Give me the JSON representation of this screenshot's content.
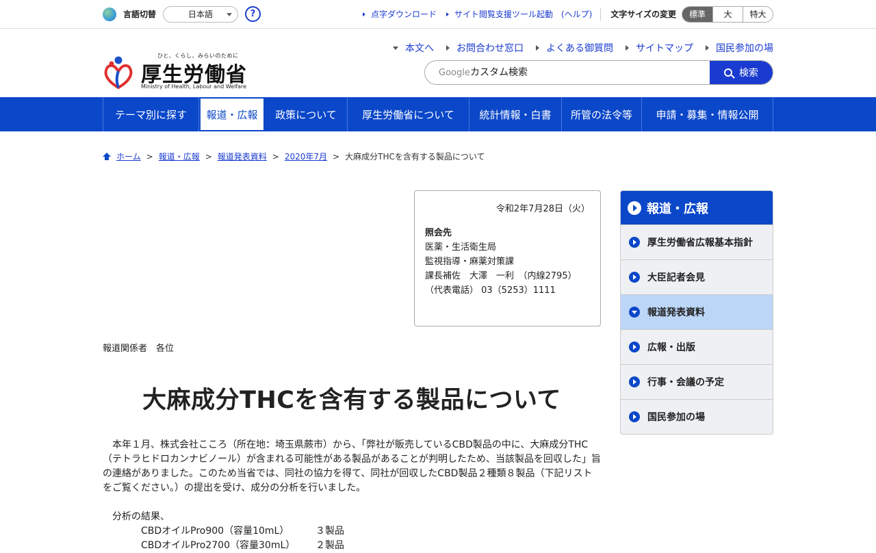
{
  "utility": {
    "language_label": "言語切替",
    "language_value": "日本語",
    "help_symbol": "?",
    "links": [
      "点字ダウンロード",
      "サイト閲覧支援ツール起動"
    ],
    "help_paren": "(ヘルプ)",
    "font_size_label": "文字サイズの変更",
    "font_sizes": [
      "標準",
      "大",
      "特大"
    ]
  },
  "header": {
    "logo_tagline": "ひと、くらし、みらいのために",
    "logo_text": "厚生労働省",
    "logo_en": "Ministry of Health, Labour and Welfare",
    "links": [
      "本文へ",
      "お問合わせ窓口",
      "よくある御質問",
      "サイトマップ",
      "国民参加の場"
    ],
    "search_brand": "Google",
    "search_placeholder": "カスタム検索",
    "search_button": "検索"
  },
  "nav": {
    "items": [
      "テーマ別に探す",
      "報道・広報",
      "政策について",
      "厚生労働省について",
      "統計情報・白書",
      "所管の法令等",
      "申請・募集・情報公開"
    ],
    "active_index": 1
  },
  "breadcrumb": {
    "items": [
      "ホーム",
      "報道・広報",
      "報道発表資料",
      "2020年7月"
    ],
    "current": "大麻成分THCを含有する製品について"
  },
  "contact": {
    "date": "令和2年7月28日（火）",
    "title": "照会先",
    "lines": [
      "医薬・生活衛生局",
      "監視指導・麻薬対策課",
      "課長補佐　大澤　一利　（内線2795）",
      "（代表電話） 03（5253）1111"
    ]
  },
  "addressee": "報道関係者　各位",
  "page_title": "大麻成分THCを含有する製品について",
  "body": {
    "paragraph": "本年１月、株式会社こころ（所在地：埼玉県蕨市）から、「弊社が販売しているCBD製品の中に、大麻成分THC（テトラヒドロカンナビノール）が含まれる可能性がある製品があることが判明したため、当該製品を回収した」旨の連絡がありました。このため当省では、同社の協力を得て、同社が回収したCBD製品２種類８製品（下記リストをご覧ください。）の提出を受け、成分の分析を行いました。",
    "results_heading": "分析の結果、",
    "results": [
      {
        "name": "CBDオイルPro900（容量10mL）",
        "count": "３製品"
      },
      {
        "name": "CBDオイルPro2700（容量30mL）",
        "count": "２製品"
      }
    ]
  },
  "sidebar": {
    "title": "報道・広報",
    "items": [
      "厚生労働省広報基本指針",
      "大臣記者会見",
      "報道発表資料",
      "広報・出版",
      "行事・会議の予定",
      "国民参加の場"
    ],
    "active_index": 2
  }
}
